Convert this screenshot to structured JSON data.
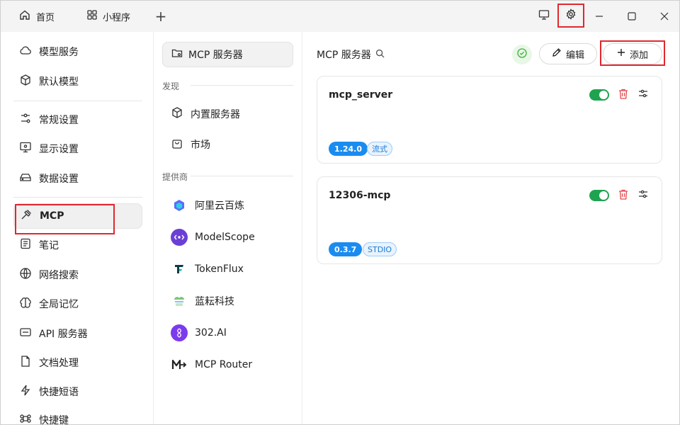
{
  "titlebar": {
    "tabs": [
      {
        "label": "首页",
        "icon": "home-icon"
      },
      {
        "label": "小程序",
        "icon": "grid-icon"
      }
    ],
    "add_tab_symbol": "+",
    "window_controls": [
      "minimize",
      "maximize",
      "close"
    ]
  },
  "nav": {
    "items": [
      {
        "label": "模型服务",
        "icon": "cloud-icon"
      },
      {
        "label": "默认模型",
        "icon": "cube-icon"
      },
      {
        "label": "常规设置",
        "icon": "sliders-icon"
      },
      {
        "label": "显示设置",
        "icon": "monitor-icon"
      },
      {
        "label": "数据设置",
        "icon": "drive-icon"
      },
      {
        "label": "MCP",
        "icon": "hammer-icon",
        "active": true
      },
      {
        "label": "笔记",
        "icon": "note-icon"
      },
      {
        "label": "网络搜索",
        "icon": "globe-icon"
      },
      {
        "label": "全局记忆",
        "icon": "brain-icon"
      },
      {
        "label": "API 服务器",
        "icon": "api-icon"
      },
      {
        "label": "文档处理",
        "icon": "document-icon"
      },
      {
        "label": "快捷短语",
        "icon": "zap-icon"
      },
      {
        "label": "快捷键",
        "icon": "command-icon"
      }
    ]
  },
  "mid": {
    "selected": "MCP 服务器",
    "discover_title": "发现",
    "discover_items": [
      {
        "label": "内置服务器",
        "icon": "package-icon"
      },
      {
        "label": "市场",
        "icon": "shopping-bag-icon"
      }
    ],
    "providers_title": "提供商",
    "providers": [
      {
        "label": "阿里云百炼",
        "icon": "aliyun-bailian-logo"
      },
      {
        "label": "ModelScope",
        "icon": "modelscope-logo"
      },
      {
        "label": "TokenFlux",
        "icon": "tokenflux-logo"
      },
      {
        "label": "蓝耘科技",
        "icon": "lanyun-logo"
      },
      {
        "label": "302.AI",
        "icon": "302ai-logo"
      },
      {
        "label": "MCP Router",
        "icon": "mcp-router-logo"
      }
    ]
  },
  "main": {
    "title": "MCP 服务器",
    "edit_label": "编辑",
    "add_label": "添加",
    "servers": [
      {
        "name": "mcp_server",
        "version": "1.24.0",
        "type": "流式",
        "enabled": true
      },
      {
        "name": "12306-mcp",
        "version": "0.3.7",
        "type": "STDIO",
        "enabled": true
      }
    ]
  },
  "colors": {
    "accent_blue": "#1a8cf0",
    "toggle_green": "#1fa350",
    "highlight_red": "#e0282e",
    "delete_red": "#e5484d"
  }
}
